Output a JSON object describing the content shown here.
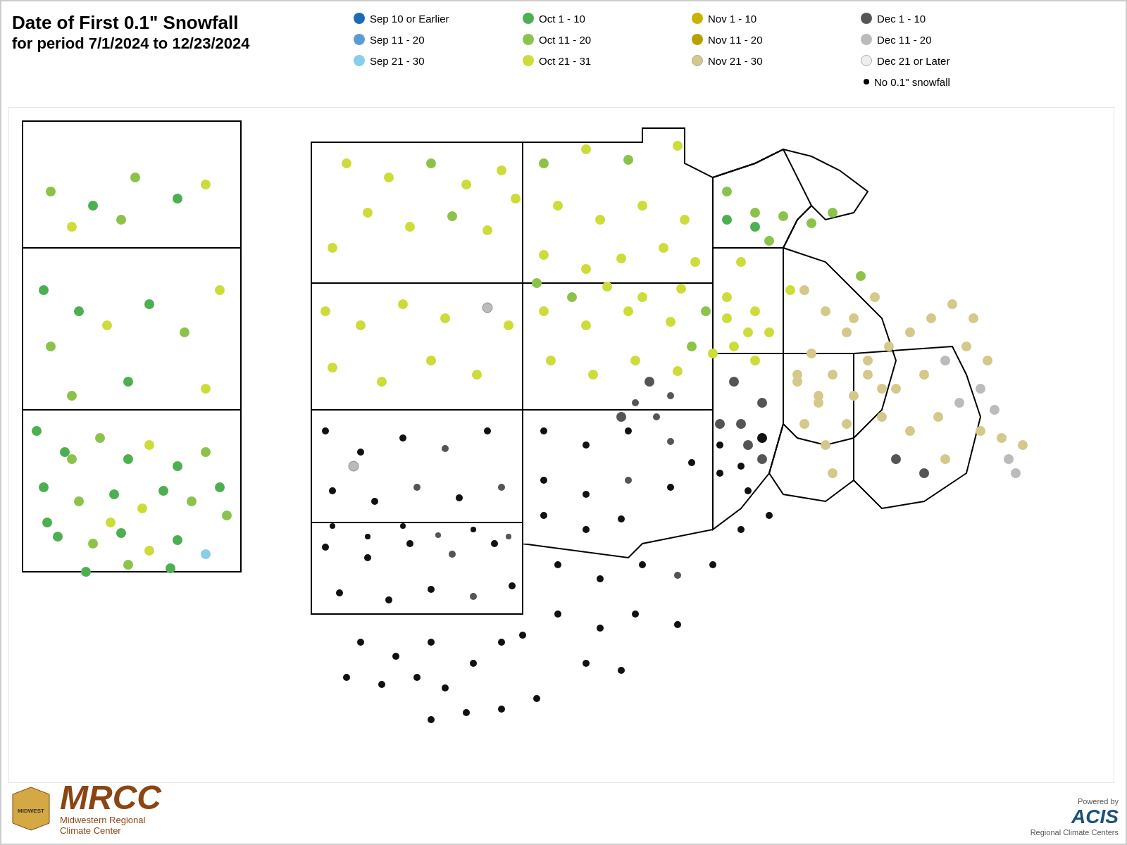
{
  "title": {
    "line1": "Date of First 0.1\" Snowfall",
    "line2": "for period 7/1/2024 to 12/23/2024"
  },
  "legend": {
    "items": [
      {
        "label": "Sep 10 or Earlier",
        "color": "#1a6bb5",
        "col": 1,
        "row": 1
      },
      {
        "label": "Oct 1 - 10",
        "color": "#4caf50",
        "col": 2,
        "row": 1
      },
      {
        "label": "Nov 1 - 10",
        "color": "#c8b400",
        "col": 3,
        "row": 1
      },
      {
        "label": "Dec 1 - 10",
        "color": "#555",
        "col": 4,
        "row": 1
      },
      {
        "label": "Sep 11 - 20",
        "color": "#5b9bd5",
        "col": 1,
        "row": 2
      },
      {
        "label": "Oct 11 - 20",
        "color": "#8bc34a",
        "col": 2,
        "row": 2
      },
      {
        "label": "Nov 11 - 20",
        "color": "#b8a000",
        "col": 3,
        "row": 2
      },
      {
        "label": "Dec 11 - 20",
        "color": "#999",
        "col": 4,
        "row": 2
      },
      {
        "label": "Sep 21 - 30",
        "color": "#87ceeb",
        "col": 1,
        "row": 3
      },
      {
        "label": "Oct 21 - 31",
        "color": "#cddc39",
        "col": 2,
        "row": 3
      },
      {
        "label": "Nov 21 - 30",
        "color": "#d4c88a",
        "col": 3,
        "row": 3
      },
      {
        "label": "Dec 21 or Later",
        "color": "#ddd",
        "col": 4,
        "row": 3
      },
      {
        "label": "No 0.1\" snowfall",
        "color": "#000",
        "col": 4,
        "row": 4,
        "small": true
      }
    ]
  },
  "mrcc": {
    "letters": "MRCC",
    "subtitle_line1": "Midwestern Regional",
    "subtitle_line2": "Climate Center"
  },
  "acis": {
    "powered_by": "Powered by",
    "name": "ACIS",
    "subtitle": "Regional Climate Centers"
  }
}
